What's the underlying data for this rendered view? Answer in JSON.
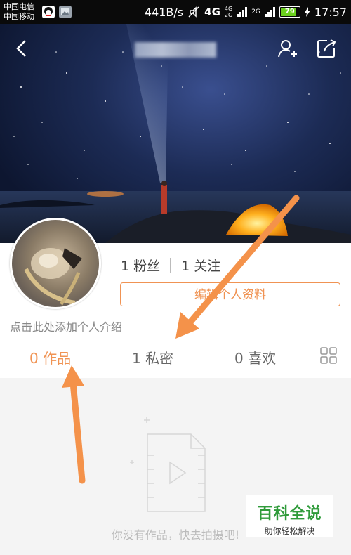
{
  "status_bar": {
    "carrier1": "中国电信",
    "carrier2": "中国移动",
    "net_speed": "441B/s",
    "network": "4G",
    "sim1_type": "4G",
    "sim2_type": "2G",
    "sim3_type": "2G",
    "battery": "79",
    "time": "17:57"
  },
  "profile": {
    "fans": "1 粉丝",
    "following": "1 关注",
    "edit_profile": "编辑个人资料",
    "bio_placeholder": "点击此处添加个人介绍"
  },
  "tabs": [
    {
      "label": "0 作品",
      "active": true
    },
    {
      "label": "1 私密",
      "active": false
    },
    {
      "label": "0 喜欢",
      "active": false
    }
  ],
  "empty_state": {
    "message": "你没有作品，快去拍摄吧!"
  },
  "watermark": {
    "title": "百科全说",
    "subtitle": "助你轻松解决"
  },
  "colors": {
    "accent": "#f09353",
    "annotation_arrow": "#f4924a",
    "watermark_green": "#2f9b3a"
  }
}
